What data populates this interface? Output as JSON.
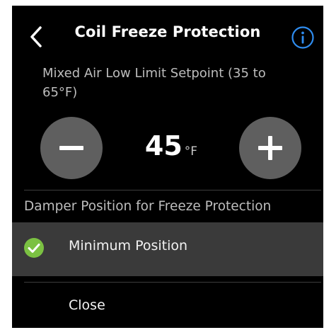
{
  "header": {
    "title": "Coil Freeze Protection",
    "back_icon": "chevron-left-icon",
    "info_icon": "info-icon"
  },
  "setpoint": {
    "label": "Mixed Air Low Limit Setpoint (35 to 65°F)",
    "value": "45",
    "unit": "°F",
    "decrement_icon": "minus-icon",
    "increment_icon": "plus-icon"
  },
  "damper": {
    "section_label": "Damper Position for Freeze Protection",
    "options": [
      {
        "label": "Minimum Position",
        "selected": true,
        "icon": "check-circle-icon"
      }
    ]
  },
  "footer": {
    "close_label": "Close"
  },
  "colors": {
    "background": "#000000",
    "accent_info": "#2f8df0",
    "check_green": "#7bc142",
    "button_gray": "#5f5f5f",
    "selected_row": "#3a3a3a"
  }
}
